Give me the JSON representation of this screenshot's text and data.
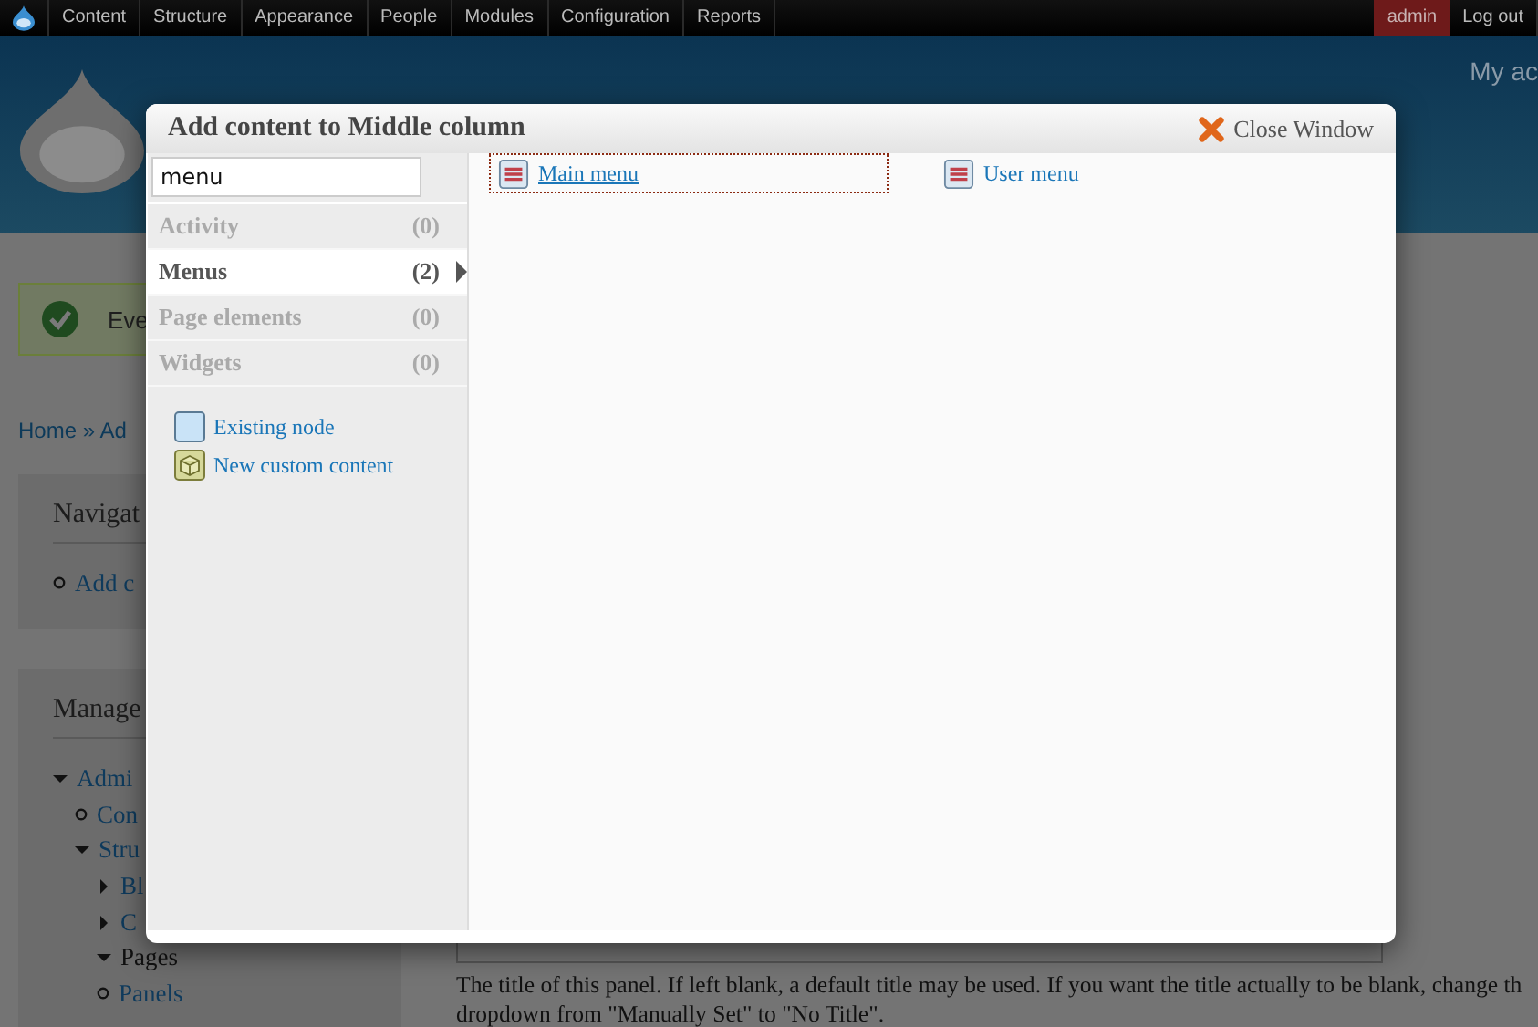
{
  "toolbar": {
    "items": [
      "Content",
      "Structure",
      "Appearance",
      "People",
      "Modules",
      "Configuration",
      "Reports"
    ],
    "user": "admin",
    "logout": "Log out"
  },
  "header": {
    "user_link": "My ac"
  },
  "message": {
    "text": "Eve"
  },
  "breadcrumb": "Home » Ad",
  "navigation_block": {
    "title": "Navigat",
    "items": [
      "Add c"
    ]
  },
  "management_block": {
    "title": "Manage",
    "tree": [
      {
        "label": "Admi",
        "kind": "branch",
        "expanded": true,
        "active": false,
        "children": [
          {
            "label": "Con",
            "kind": "leaf",
            "active": false
          },
          {
            "label": "Stru",
            "kind": "branch",
            "expanded": true,
            "active": false,
            "children": [
              {
                "label": "Bl",
                "kind": "branch",
                "expanded": false,
                "active": false
              },
              {
                "label": "C",
                "kind": "branch",
                "expanded": false,
                "active": false
              },
              {
                "label": "Pages",
                "kind": "branch",
                "expanded": true,
                "active": true
              },
              {
                "label": "Panels",
                "kind": "leaf",
                "active": false
              }
            ]
          }
        ]
      }
    ]
  },
  "field_description": [
    "The title of this panel. If left blank, a default title may be used. If you want the title actually to be blank, change th",
    "dropdown from \"Manually Set\" to \"No Title\"."
  ],
  "modal": {
    "title": "Add content to Middle column",
    "close": "Close Window",
    "search": {
      "value": "menu"
    },
    "categories": [
      {
        "label": "Activity",
        "count": "(0)",
        "selected": false,
        "disabled": true
      },
      {
        "label": "Menus",
        "count": "(2)",
        "selected": true,
        "disabled": false
      },
      {
        "label": "Page elements",
        "count": "(0)",
        "selected": false,
        "disabled": true
      },
      {
        "label": "Widgets",
        "count": "(0)",
        "selected": false,
        "disabled": true
      }
    ],
    "extras": [
      {
        "label": "Existing node",
        "kind": "node"
      },
      {
        "label": "New custom content",
        "kind": "custom"
      }
    ],
    "items": [
      {
        "label": "Main menu",
        "focused": true
      },
      {
        "label": "User menu",
        "focused": false
      }
    ]
  }
}
